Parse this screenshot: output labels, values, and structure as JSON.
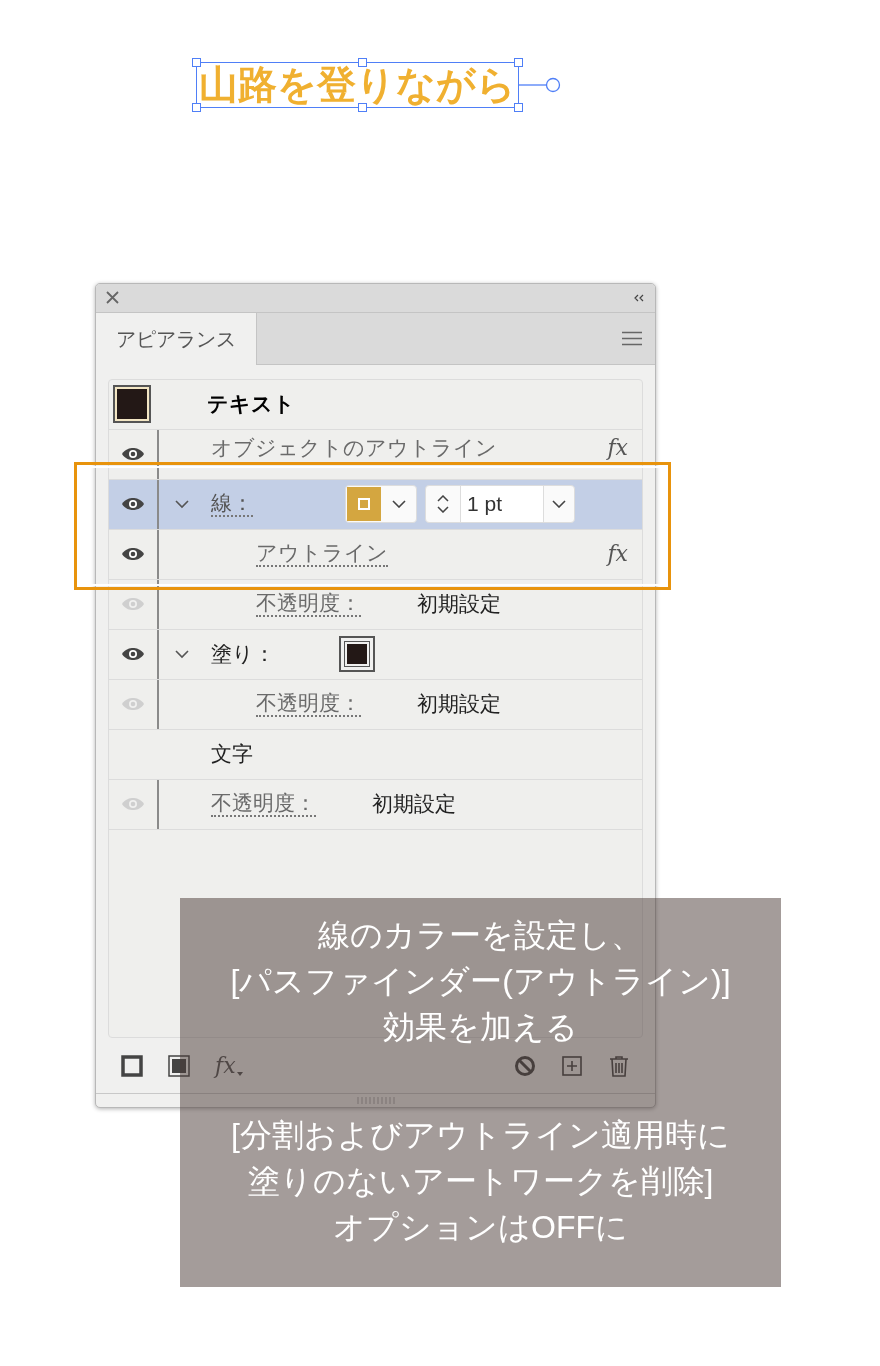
{
  "canvas": {
    "text": "山路を登りながら",
    "selected": true
  },
  "panel": {
    "tabs": [
      {
        "label": "アピアランス",
        "selected": true
      }
    ],
    "header": {
      "label": "テキスト",
      "color": "#231816"
    },
    "rows": [
      {
        "kind": "effect",
        "label": "オブジェクトのアウトライン",
        "visible": true,
        "fx": "fx"
      },
      {
        "kind": "stroke",
        "label": "線：",
        "visible": true,
        "expanded": true,
        "selected": true,
        "color": "#d4a640",
        "weight": "1 pt",
        "children": [
          {
            "kind": "effect",
            "label": "アウトライン",
            "visible": true,
            "fx": "fx"
          },
          {
            "kind": "opacity",
            "label": "不透明度：",
            "value": "初期設定",
            "visible": false
          }
        ]
      },
      {
        "kind": "fill",
        "label": "塗り：",
        "visible": true,
        "expanded": true,
        "selected": false,
        "color": "#231816",
        "children": [
          {
            "kind": "opacity",
            "label": "不透明度：",
            "value": "初期設定",
            "visible": false
          }
        ]
      },
      {
        "kind": "plain",
        "label": "文字"
      },
      {
        "kind": "opacity",
        "label": "不透明度：",
        "value": "初期設定",
        "visible": false
      }
    ],
    "toolbar": {
      "fx": "fx"
    }
  },
  "notes": [
    {
      "lines": [
        "線のカラーを設定し、",
        "[パスファインダー(アウトライン)]",
        "効果を加える"
      ]
    },
    {
      "lines": [
        "[分割およびアウトライン適用時に",
        "塗りのないアートワークを削除]",
        "オプションはOFFに"
      ]
    }
  ]
}
